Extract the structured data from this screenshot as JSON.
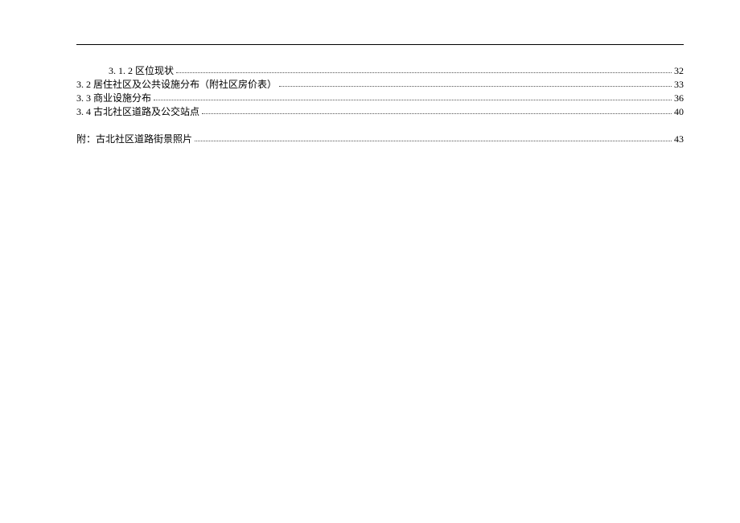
{
  "toc": [
    {
      "indent": 2,
      "title": "3. 1. 2 区位现状",
      "page": "32"
    },
    {
      "indent": 1,
      "title": "3. 2 居住社区及公共设施分布（附社区房价表）",
      "page": "33"
    },
    {
      "indent": 1,
      "title": "3. 3 商业设施分布",
      "page": "36"
    },
    {
      "indent": 1,
      "title": "3. 4 古北社区道路及公交站点",
      "page": "40"
    },
    {
      "indent": 1,
      "title": "附：古北社区道路街景照片",
      "page": "43"
    }
  ]
}
